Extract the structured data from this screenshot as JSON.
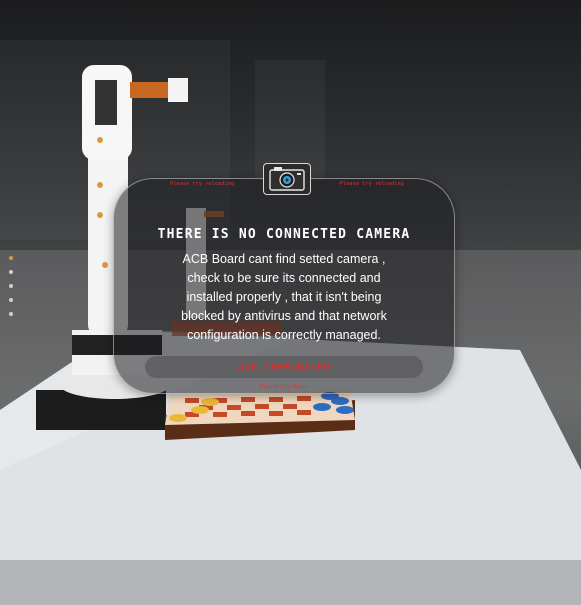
{
  "modal": {
    "corner_left": "Please try reloading",
    "corner_right": "Please try reloading",
    "camera_icon": "camera-icon",
    "title": "THERE IS NO CONNECTED CAMERA",
    "message_lines": [
      "ACB Board cant find setted camera ,",
      "check to be sure its connected and",
      "installed properly , that it isn't being",
      "blocked by antivirus and that network",
      "configuration is correctly managed."
    ],
    "terminate_label": "ACB TERMINATED",
    "retry_label": "Please Try Again"
  },
  "side_indicator": {
    "count": 5,
    "active_index": 0
  },
  "colors": {
    "accent_red": "#e02a2a",
    "modal_border": "#ffffff",
    "active_dot": "#d99a3e"
  }
}
